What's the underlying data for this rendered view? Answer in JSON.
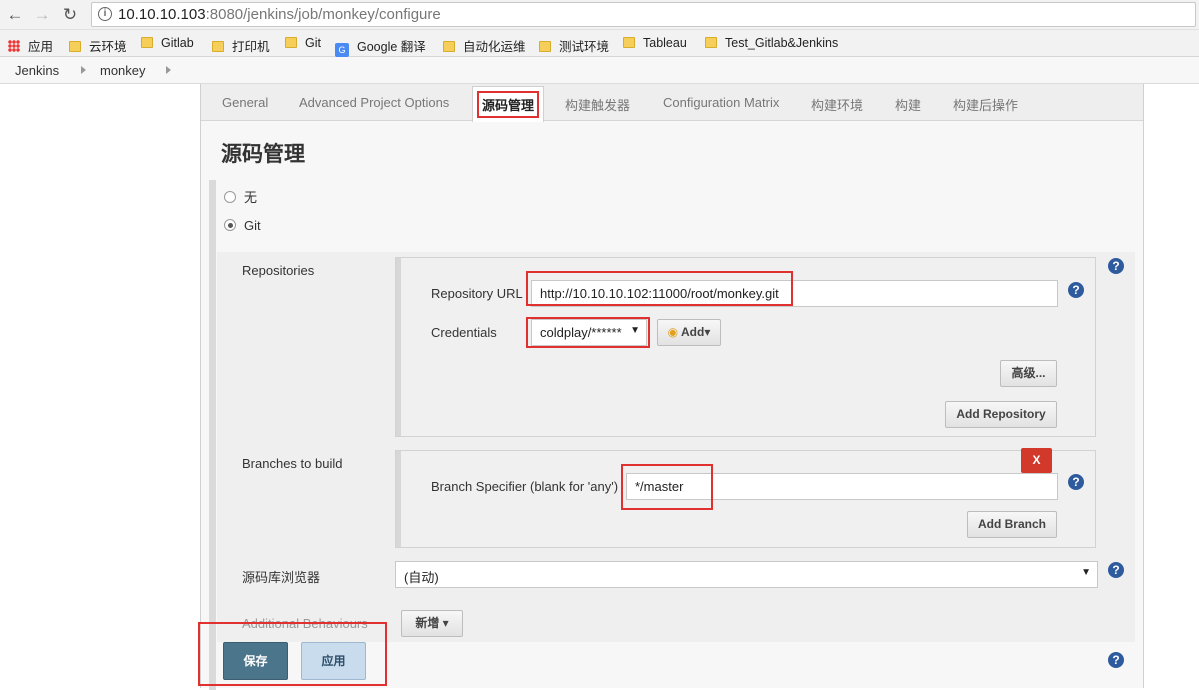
{
  "browser": {
    "url_host": "10.10.10.103",
    "url_rest": ":8080/jenkins/job/monkey/configure",
    "bookmarks": [
      "应用",
      "云环境",
      "Gitlab",
      "打印机",
      "Git",
      "Google 翻译",
      "自动化运维",
      "测试环境",
      "Tableau",
      "Test_Gitlab&Jenkins"
    ]
  },
  "breadcrumb": [
    "Jenkins",
    "monkey"
  ],
  "tabs": [
    "General",
    "Advanced Project Options",
    "源码管理",
    "构建触发器",
    "Configuration Matrix",
    "构建环境",
    "构建",
    "构建后操作"
  ],
  "active_tab": "源码管理",
  "section": {
    "title": "源码管理",
    "scm_options": [
      "无",
      "Git"
    ],
    "selected_scm": "Git"
  },
  "repositories": {
    "label": "Repositories",
    "url_label": "Repository URL",
    "url_value": "http://10.10.10.102:11000/root/monkey.git",
    "credentials_label": "Credentials",
    "credentials_value": "coldplay/******",
    "add_label": "Add",
    "advanced_label": "高级...",
    "add_repository_label": "Add Repository"
  },
  "branches": {
    "label": "Branches to build",
    "delete_label": "X",
    "specifier_label": "Branch Specifier (blank for 'any')",
    "specifier_value": "*/master",
    "add_branch_label": "Add Branch"
  },
  "repo_browser": {
    "label": "源码库浏览器",
    "value": "(自动)"
  },
  "additional": {
    "label": "Additional Behaviours",
    "add_label": "新增"
  },
  "actions": {
    "save_label": "保存",
    "apply_label": "应用"
  },
  "colors": {
    "highlight": "#e03030",
    "save": "#4b758b",
    "apply": "#c8dcee",
    "delete": "#d2392b",
    "help": "#2e5a9e"
  }
}
